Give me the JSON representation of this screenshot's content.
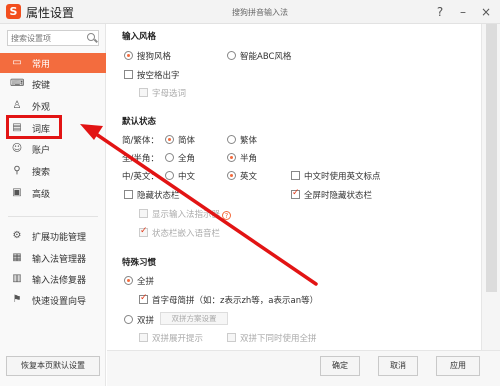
{
  "window": {
    "title": "属性设置",
    "subtitle": "搜狗拼音输入法",
    "help": "?",
    "minimize": "–",
    "close": "×",
    "logo": "S"
  },
  "sidebar": {
    "search_placeholder": "搜索设置项",
    "items": [
      {
        "label": "常用",
        "icon": "monitor-icon",
        "glyph": "▭"
      },
      {
        "label": "按键",
        "icon": "keyboard-icon",
        "glyph": "⌨"
      },
      {
        "label": "外观",
        "icon": "shirt-icon",
        "glyph": "♙"
      },
      {
        "label": "词库",
        "icon": "book-icon",
        "glyph": "▤"
      },
      {
        "label": "账户",
        "icon": "user-icon",
        "glyph": "☺"
      },
      {
        "label": "搜索",
        "icon": "search-icon",
        "glyph": "⚲"
      },
      {
        "label": "高级",
        "icon": "advanced-icon",
        "glyph": "▣"
      }
    ],
    "tools": [
      {
        "label": "扩展功能管理",
        "icon": "extension-icon",
        "glyph": "⚙"
      },
      {
        "label": "输入法管理器",
        "icon": "manager-icon",
        "glyph": "▦"
      },
      {
        "label": "输入法修复器",
        "icon": "repair-icon",
        "glyph": "▥"
      },
      {
        "label": "快速设置向导",
        "icon": "flag-icon",
        "glyph": "⚑"
      }
    ],
    "reset": "恢复本页默认设置"
  },
  "input_style": {
    "title": "输入风格",
    "opt1": "搜狗风格",
    "opt2": "智能ABC风格",
    "space_cb": "按空格出字",
    "letter_cb": "字母选词"
  },
  "default_state": {
    "title": "默认状态",
    "trad_label": "简/繁体：",
    "simp": "简体",
    "trad": "繁体",
    "width_label": "全/半角：",
    "full": "全角",
    "half": "半角",
    "lang_label": "中/英文：",
    "cn": "中文",
    "en": "英文",
    "cn_en_punct": "中文时使用英文标点",
    "hide_status": "隐藏状态栏",
    "fullscreen_hide": "全屏时隐藏状态栏",
    "show_indicator": "显示输入法指示器",
    "embed_voice": "状态栏嵌入语音栏"
  },
  "special": {
    "title": "特殊习惯",
    "quanpin": "全拼",
    "initials": "首字母简拼（如：z表示zh等，a表示an等）",
    "shuangpin": "双拼",
    "scheme_btn": "双拼方案设置",
    "sp_tip": "双拼展开提示",
    "sp_use_qp": "双拼下同时使用全拼"
  },
  "footer": {
    "ok": "确定",
    "cancel": "取消",
    "apply": "应用"
  },
  "colors": {
    "accent": "#f36c3e",
    "annotation": "#e21414"
  }
}
